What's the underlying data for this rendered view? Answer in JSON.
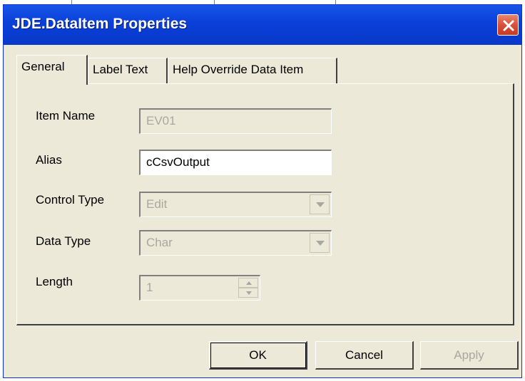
{
  "dialog": {
    "title": "JDE.DataItem Properties"
  },
  "tabs": [
    {
      "label": "General"
    },
    {
      "label": "Label Text"
    },
    {
      "label": "Help Override Data Item"
    }
  ],
  "fields": {
    "item_name": {
      "label": "Item Name",
      "value": "EV01"
    },
    "alias": {
      "label": "Alias",
      "value": "cCsvOutput"
    },
    "control_type": {
      "label": "Control Type",
      "value": "Edit"
    },
    "data_type": {
      "label": "Data Type",
      "value": "Char"
    },
    "length": {
      "label": "Length",
      "value": "1"
    }
  },
  "buttons": {
    "ok": "OK",
    "cancel": "Cancel",
    "apply": "Apply"
  },
  "colors": {
    "titlebar": "#0a3fd8",
    "close_button": "#d8503a",
    "dialog_face": "#ece9d8",
    "disabled_text": "#a8a8a0"
  }
}
